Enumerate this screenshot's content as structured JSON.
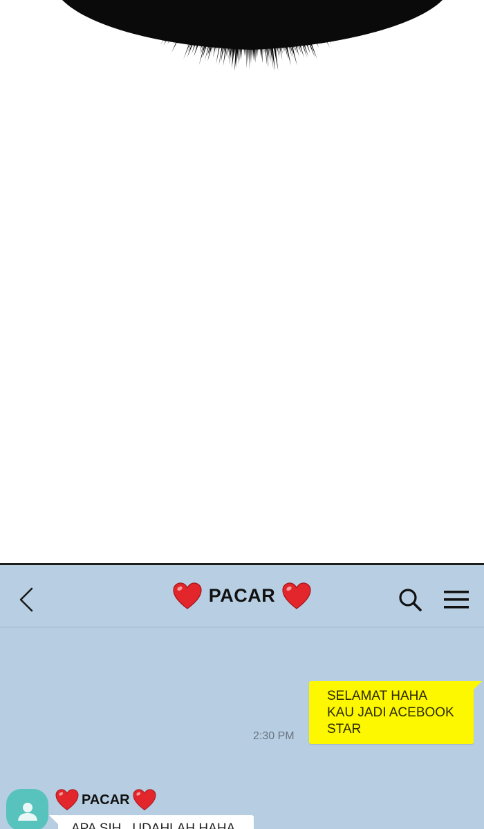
{
  "chat": {
    "title": "PACAR",
    "title_icon_left": "heart-icon",
    "title_icon_right": "heart-icon",
    "header_icons": [
      "back-chevron-icon",
      "search-icon",
      "menu-icon"
    ],
    "background_color": "#b6cde2",
    "messages": [
      {
        "direction": "outgoing",
        "text": "SELAMAT HAHA\nKAU JADI ACEBOOK\nSTAR",
        "time": "2:30 PM",
        "bubble_color": "#fdf700"
      },
      {
        "direction": "incoming",
        "sender": "PACAR",
        "text": "APA SIH.. UDAHLAH HAHA",
        "bubble_color": "#ffffff"
      }
    ]
  },
  "comic": {
    "art": "black spiky hair silhouette at top of panel"
  }
}
